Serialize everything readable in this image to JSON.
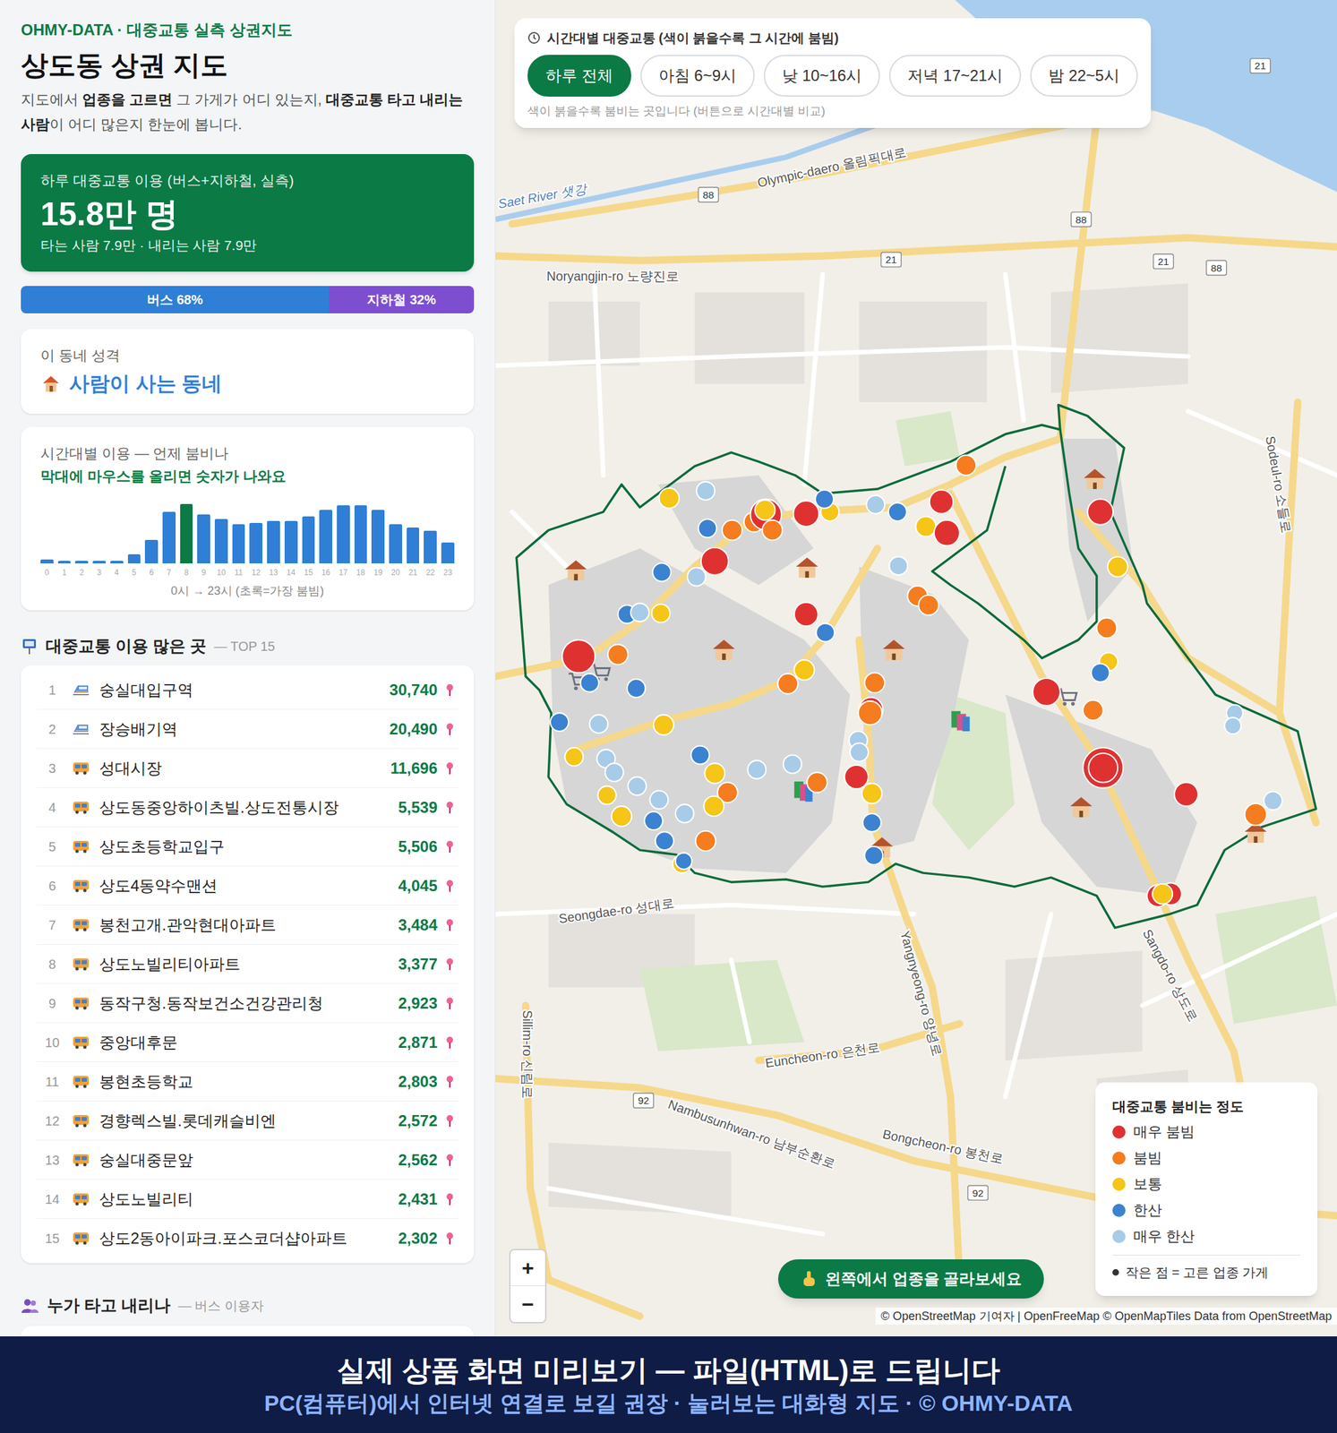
{
  "header": {
    "brand": "OHMY-DATA · 대중교통 실측 상권지도",
    "title": "상도동 상권 지도",
    "description": [
      {
        "text": "지도에서 ",
        "bold": false
      },
      {
        "text": "업종을 고르면",
        "bold": true
      },
      {
        "text": " 그 가게가 어디 있는지, ",
        "bold": false
      },
      {
        "text": "대중교통 타고 내리는 사람",
        "bold": true
      },
      {
        "text": "이 어디 많은지 한눈에 봅니다.",
        "bold": false
      }
    ]
  },
  "summary": {
    "label": "하루 대중교통 이용 (버스+지하철, 실측)",
    "value": "15.8만 명",
    "detail": "타는 사람 7.9만 · 내리는 사람 7.9만"
  },
  "split": [
    {
      "label": "버스 68%",
      "level": 0.68,
      "color": "#2f7fd6"
    },
    {
      "label": "지하철 32%",
      "level": 0.32,
      "color": "#7d4fd0"
    }
  ],
  "character": {
    "label": "이 동네 성격",
    "value": "사람이 사는 동네"
  },
  "hourly": {
    "title": "시간대별 이용 — 언제 붐비나",
    "hint": "막대에 마우스를 올리면 숫자가 나와요",
    "caption": "0시 → 23시 (초록=가장 붐빔)",
    "bars": [
      {
        "hour": "0",
        "value": 730,
        "peak": false
      },
      {
        "hour": "1",
        "value": 550,
        "peak": false
      },
      {
        "hour": "2",
        "value": 550,
        "peak": false
      },
      {
        "hour": "3",
        "value": 550,
        "peak": false
      },
      {
        "hour": "4",
        "value": 550,
        "peak": false
      },
      {
        "hour": "5",
        "value": 1820,
        "peak": false
      },
      {
        "hour": "6",
        "value": 4550,
        "peak": false
      },
      {
        "hour": "7",
        "value": 10000,
        "peak": false
      },
      {
        "hour": "8",
        "value": 11500,
        "peak": true
      },
      {
        "hour": "9",
        "value": 9460,
        "peak": false
      },
      {
        "hour": "10",
        "value": 8550,
        "peak": false
      },
      {
        "hour": "11",
        "value": 7640,
        "peak": false
      },
      {
        "hour": "12",
        "value": 7830,
        "peak": false
      },
      {
        "hour": "13",
        "value": 8190,
        "peak": false
      },
      {
        "hour": "14",
        "value": 8190,
        "peak": false
      },
      {
        "hour": "15",
        "value": 9100,
        "peak": false
      },
      {
        "hour": "16",
        "value": 10370,
        "peak": false
      },
      {
        "hour": "17",
        "value": 11280,
        "peak": false
      },
      {
        "hour": "18",
        "value": 11280,
        "peak": false
      },
      {
        "hour": "19",
        "value": 10370,
        "peak": false
      },
      {
        "hour": "20",
        "value": 7640,
        "peak": false
      },
      {
        "hour": "21",
        "value": 6920,
        "peak": false
      },
      {
        "hour": "22",
        "value": 6370,
        "peak": false
      },
      {
        "hour": "23",
        "value": 4000,
        "peak": false
      }
    ]
  },
  "top": {
    "title": "대중교통 이용 많은 곳",
    "suffix": "— TOP 15",
    "items": [
      {
        "rank": "1",
        "kind": "subway",
        "name": "숭실대입구역",
        "count": "30,740"
      },
      {
        "rank": "2",
        "kind": "subway",
        "name": "장승배기역",
        "count": "20,490"
      },
      {
        "rank": "3",
        "kind": "bus",
        "name": "성대시장",
        "count": "11,696"
      },
      {
        "rank": "4",
        "kind": "bus",
        "name": "상도동중앙하이츠빌.상도전통시장",
        "count": "5,539"
      },
      {
        "rank": "5",
        "kind": "bus",
        "name": "상도초등학교입구",
        "count": "5,506"
      },
      {
        "rank": "6",
        "kind": "bus",
        "name": "상도4동약수맨션",
        "count": "4,045"
      },
      {
        "rank": "7",
        "kind": "bus",
        "name": "봉천고개.관악현대아파트",
        "count": "3,484"
      },
      {
        "rank": "8",
        "kind": "bus",
        "name": "상도노빌리티아파트",
        "count": "3,377"
      },
      {
        "rank": "9",
        "kind": "bus",
        "name": "동작구청.동작보건소건강관리청",
        "count": "2,923"
      },
      {
        "rank": "10",
        "kind": "bus",
        "name": "중앙대후문",
        "count": "2,871"
      },
      {
        "rank": "11",
        "kind": "bus",
        "name": "봉현초등학교",
        "count": "2,803"
      },
      {
        "rank": "12",
        "kind": "bus",
        "name": "경향렉스빌.롯데캐슬비엔",
        "count": "2,572"
      },
      {
        "rank": "13",
        "kind": "bus",
        "name": "숭실대중문앞",
        "count": "2,562"
      },
      {
        "rank": "14",
        "kind": "bus",
        "name": "상도노빌리티",
        "count": "2,431"
      },
      {
        "rank": "15",
        "kind": "bus",
        "name": "상도2동아이파크.포스코더샵아파트",
        "count": "2,302"
      }
    ]
  },
  "riders": {
    "title": "누가 타고 내리나",
    "suffix": "— 버스 이용자"
  },
  "time_filter": {
    "title": "시간대별 대중교통 (색이 붉을수록 그 시간에 붐빔)",
    "caption": "색이 붉을수록 붐비는 곳입니다 (버튼으로 시간대별 비교)",
    "buttons": [
      {
        "label": "하루 전체",
        "selected": true
      },
      {
        "label": "아침 6~9시",
        "selected": false
      },
      {
        "label": "낮 10~16시",
        "selected": false
      },
      {
        "label": "저녁 17~21시",
        "selected": false
      },
      {
        "label": "밤 22~5시",
        "selected": false
      }
    ]
  },
  "legend": {
    "title": "대중교통 붐비는 정도",
    "items": [
      {
        "label": "매우 붐빔",
        "color": "#e03131"
      },
      {
        "label": "붐빔",
        "color": "#f57c1f"
      },
      {
        "label": "보통",
        "color": "#f5c518"
      },
      {
        "label": "한산",
        "color": "#3b82d0"
      },
      {
        "label": "매우 한산",
        "color": "#a8cbe8"
      }
    ],
    "note": "작은 점 = 고른 업종 가게"
  },
  "cta": "왼쪽에서 업종을 골라보세요",
  "zoom": [
    "+",
    "−"
  ],
  "attribution": "© OpenStreetMap 기여자 | OpenFreeMap © OpenMapTiles Data from OpenStreetMap",
  "map": {
    "labels": [
      {
        "text": "Olympic-daero 올림픽대로"
      },
      {
        "text": "Saet River 샛강"
      },
      {
        "text": "Noryangjin-ro 노량진로"
      },
      {
        "text": "Sangdo-ro 상도로"
      },
      {
        "text": "Seongdae-ro 성대로"
      },
      {
        "text": "Yangnyeong-ro 양녕로"
      },
      {
        "text": "Euncheon-ro 은천로"
      },
      {
        "text": "Nambusunhwan-ro 남부순환로"
      },
      {
        "text": "Bongcheon-ro 봉천로"
      },
      {
        "text": "Sillim-ro 신림로"
      },
      {
        "text": "Sodeul-ro 소들로"
      }
    ],
    "shields": [
      {
        "text": "88"
      },
      {
        "text": "88"
      },
      {
        "text": "88"
      },
      {
        "text": "21"
      },
      {
        "text": "21"
      },
      {
        "text": "21"
      },
      {
        "text": "92"
      },
      {
        "text": "92"
      }
    ],
    "stops": [
      {
        "color": "#e03131"
      },
      {
        "color": "#f57c1f"
      },
      {
        "color": "#3b82d0"
      },
      {
        "color": "#3b82d0"
      },
      {
        "color": "#a8cbe8"
      },
      {
        "color": "#f5c518"
      },
      {
        "color": "#a8cbe8"
      },
      {
        "color": "#a8cbe8"
      },
      {
        "color": "#f5c518"
      },
      {
        "color": "#f5c518"
      },
      {
        "color": "#a8cbe8"
      },
      {
        "color": "#3b82d0"
      },
      {
        "color": "#a8cbe8"
      },
      {
        "color": "#3b82d0"
      },
      {
        "color": "#a8cbe8"
      },
      {
        "color": "#f5c518"
      },
      {
        "color": "#3b82d0"
      },
      {
        "color": "#f57c1f"
      },
      {
        "color": "#3b82d0"
      },
      {
        "color": "#f5c518"
      },
      {
        "color": "#f57c1f"
      },
      {
        "color": "#f5c518"
      },
      {
        "color": "#a8cbe8"
      },
      {
        "color": "#a8cbe8"
      },
      {
        "color": "#f57c1f"
      },
      {
        "color": "#f5c518"
      },
      {
        "color": "#3b82d0"
      },
      {
        "color": "#3b82d0"
      },
      {
        "color": "#a8cbe8"
      },
      {
        "color": "#f5c518"
      },
      {
        "color": "#3b82d0"
      },
      {
        "color": "#a8cbe8"
      },
      {
        "color": "#e03131"
      },
      {
        "color": "#3b82d0"
      },
      {
        "color": "#f5c518"
      },
      {
        "color": "#a8cbe8"
      },
      {
        "color": "#f57c1f"
      },
      {
        "color": "#f57c1f"
      },
      {
        "color": "#e03131"
      },
      {
        "color": "#f57c1f"
      },
      {
        "color": "#f5c518"
      },
      {
        "color": "#e03131"
      },
      {
        "color": "#f5c518"
      },
      {
        "color": "#3b82d0"
      },
      {
        "color": "#a8cbe8"
      },
      {
        "color": "#3b82d0"
      },
      {
        "color": "#e03131"
      },
      {
        "color": "#f5c518"
      },
      {
        "color": "#e03131"
      },
      {
        "color": "#f57c1f"
      },
      {
        "color": "#a8cbe8"
      },
      {
        "color": "#f57c1f"
      },
      {
        "color": "#f57c1f"
      },
      {
        "color": "#e03131"
      },
      {
        "color": "#3b82d0"
      },
      {
        "color": "#f5c518"
      },
      {
        "color": "#f57c1f"
      },
      {
        "color": "#f57c1f"
      },
      {
        "color": "#e03131"
      },
      {
        "color": "#f57c1f"
      },
      {
        "color": "#a8cbe8"
      },
      {
        "color": "#a8cbe8"
      },
      {
        "color": "#e03131"
      },
      {
        "color": "#f5c518"
      },
      {
        "color": "#3b82d0"
      },
      {
        "color": "#3b82d0"
      },
      {
        "color": "#e03131"
      },
      {
        "color": "#f5c518"
      },
      {
        "color": "#f57c1f"
      },
      {
        "color": "#f5c518"
      },
      {
        "color": "#3b82d0"
      },
      {
        "color": "#e03131"
      },
      {
        "color": "#f57c1f"
      },
      {
        "color": "#e03131"
      },
      {
        "color": "#e03131"
      },
      {
        "color": "#f57c1f"
      },
      {
        "color": "#a8cbe8"
      },
      {
        "color": "#a8cbe8"
      },
      {
        "color": "#a8cbe8"
      },
      {
        "color": "#e03131"
      },
      {
        "color": "#e03131"
      },
      {
        "color": "#f5c518"
      }
    ]
  },
  "banner": {
    "title": "실제 상품 화면 미리보기 — 파일(HTML)로 드립니다",
    "subtitle": "PC(컴퓨터)에서 인터넷 연결로 보길 권장 · 눌러보는 대화형 지도 · © OHMY-DATA"
  }
}
